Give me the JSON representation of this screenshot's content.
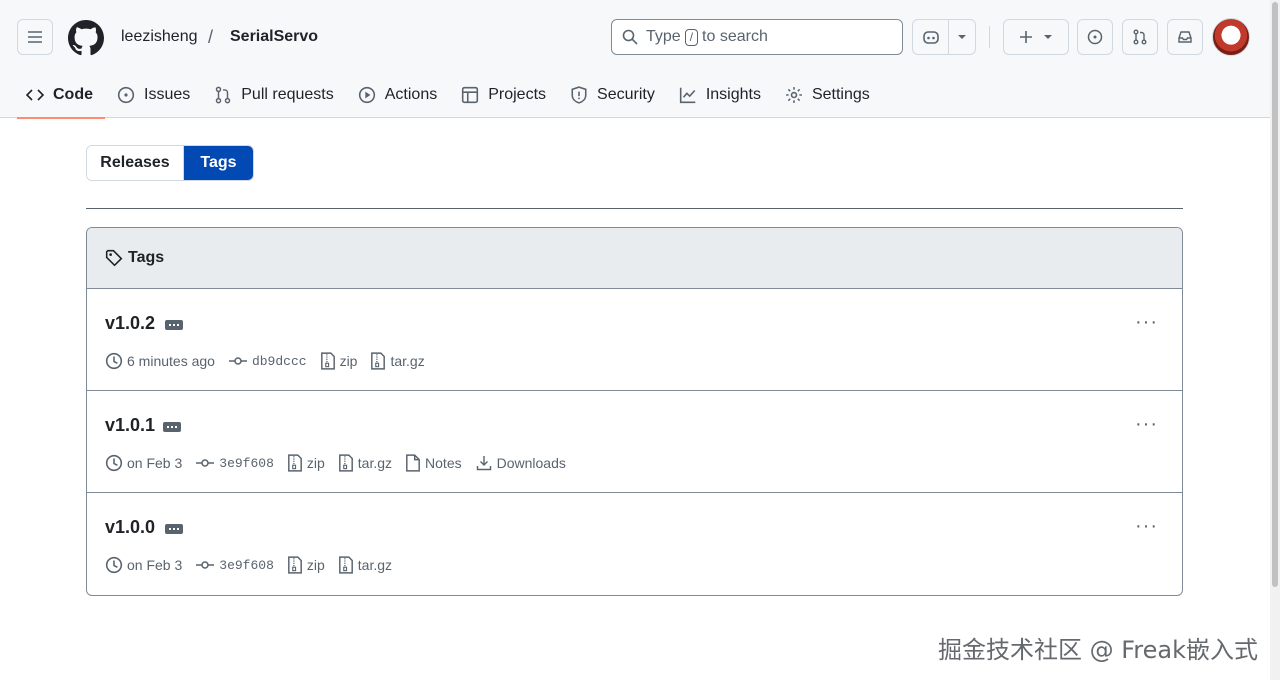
{
  "header": {
    "owner": "leezisheng",
    "separator": "/",
    "repo": "SerialServo",
    "search": {
      "prefix": "Type",
      "key": "/",
      "suffix": "to search"
    }
  },
  "nav": {
    "tabs": [
      {
        "label": "Code",
        "icon": "code-icon",
        "active": true
      },
      {
        "label": "Issues",
        "icon": "issue-opened-icon"
      },
      {
        "label": "Pull requests",
        "icon": "git-pull-request-icon"
      },
      {
        "label": "Actions",
        "icon": "play-icon"
      },
      {
        "label": "Projects",
        "icon": "table-icon"
      },
      {
        "label": "Security",
        "icon": "shield-icon"
      },
      {
        "label": "Insights",
        "icon": "graph-icon"
      },
      {
        "label": "Settings",
        "icon": "gear-icon"
      }
    ]
  },
  "toggle": {
    "releases": "Releases",
    "tags": "Tags",
    "selected": "Tags"
  },
  "tags_box": {
    "title": "Tags",
    "rows": [
      {
        "name": "v1.0.2",
        "time": "6 minutes ago",
        "sha": "db9dccc",
        "zip": "zip",
        "targz": "tar.gz"
      },
      {
        "name": "v1.0.1",
        "time": "on Feb 3",
        "sha": "3e9f608",
        "zip": "zip",
        "targz": "tar.gz",
        "notes": "Notes",
        "downloads": "Downloads"
      },
      {
        "name": "v1.0.0",
        "time": "on Feb 3",
        "sha": "3e9f608",
        "zip": "zip",
        "targz": "tar.gz"
      }
    ],
    "more": "···"
  },
  "watermark": "掘金技术社区 @ Freak嵌入式",
  "colors": {
    "accent": "#0349b4",
    "tab_underline": "#fd8c73"
  }
}
